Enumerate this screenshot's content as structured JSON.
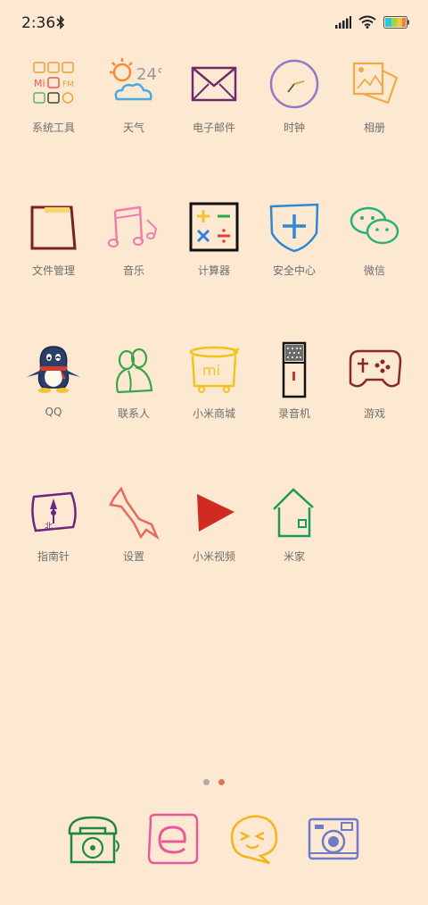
{
  "status": {
    "time": "2:36",
    "bluetooth_icon": "bluetooth-icon",
    "signal_icon": "signal-icon",
    "wifi_icon": "wifi-icon",
    "battery_icon": "battery-icon"
  },
  "apps": [
    {
      "label": "系统工具",
      "icon": "tools-folder-icon"
    },
    {
      "label": "天气",
      "icon": "weather-icon",
      "temp": "24°"
    },
    {
      "label": "电子邮件",
      "icon": "mail-icon"
    },
    {
      "label": "时钟",
      "icon": "clock-icon"
    },
    {
      "label": "相册",
      "icon": "gallery-icon"
    },
    {
      "label": "文件管理",
      "icon": "folder-icon"
    },
    {
      "label": "音乐",
      "icon": "music-icon"
    },
    {
      "label": "计算器",
      "icon": "calculator-icon"
    },
    {
      "label": "安全中心",
      "icon": "security-shield-icon"
    },
    {
      "label": "微信",
      "icon": "wechat-icon"
    },
    {
      "label": "QQ",
      "icon": "qq-penguin-icon"
    },
    {
      "label": "联系人",
      "icon": "contacts-icon"
    },
    {
      "label": "小米商城",
      "icon": "mi-store-icon",
      "badge_text": "mi"
    },
    {
      "label": "录音机",
      "icon": "recorder-icon"
    },
    {
      "label": "游戏",
      "icon": "game-controller-icon"
    },
    {
      "label": "指南针",
      "icon": "compass-icon"
    },
    {
      "label": "设置",
      "icon": "settings-wrench-icon"
    },
    {
      "label": "小米视频",
      "icon": "video-play-icon"
    },
    {
      "label": "米家",
      "icon": "home-icon"
    }
  ],
  "dock": [
    {
      "icon": "phone-icon"
    },
    {
      "icon": "browser-icon"
    },
    {
      "icon": "messages-icon"
    },
    {
      "icon": "camera-icon"
    }
  ],
  "colors": {
    "background": "#fde8d2",
    "label": "#6e6e6e",
    "page_dot_active": "#d9725e",
    "page_dot_inactive": "#b5aca3"
  }
}
